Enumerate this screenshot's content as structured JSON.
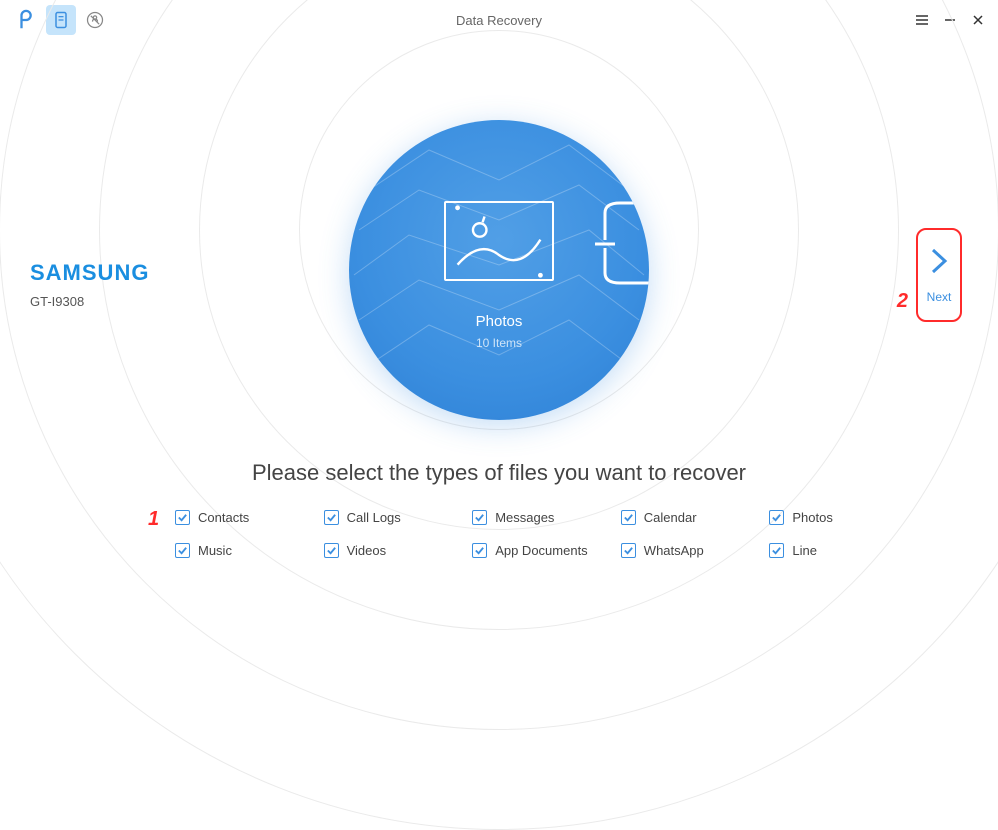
{
  "header": {
    "title": "Data Recovery"
  },
  "device": {
    "brand": "SAMSUNG",
    "model": "GT-I9308"
  },
  "center": {
    "category_label": "Photos",
    "item_count": "10 Items"
  },
  "next": {
    "label": "Next"
  },
  "instruction": "Please select the types of files you want to recover",
  "checkboxes": [
    {
      "label": "Contacts",
      "checked": true
    },
    {
      "label": "Call Logs",
      "checked": true
    },
    {
      "label": "Messages",
      "checked": true
    },
    {
      "label": "Calendar",
      "checked": true
    },
    {
      "label": "Photos",
      "checked": true
    },
    {
      "label": "Music",
      "checked": true
    },
    {
      "label": "Videos",
      "checked": true
    },
    {
      "label": "App Documents",
      "checked": true
    },
    {
      "label": "WhatsApp",
      "checked": true
    },
    {
      "label": "Line",
      "checked": true
    }
  ],
  "annotations": {
    "step1": "1",
    "step2": "2"
  }
}
